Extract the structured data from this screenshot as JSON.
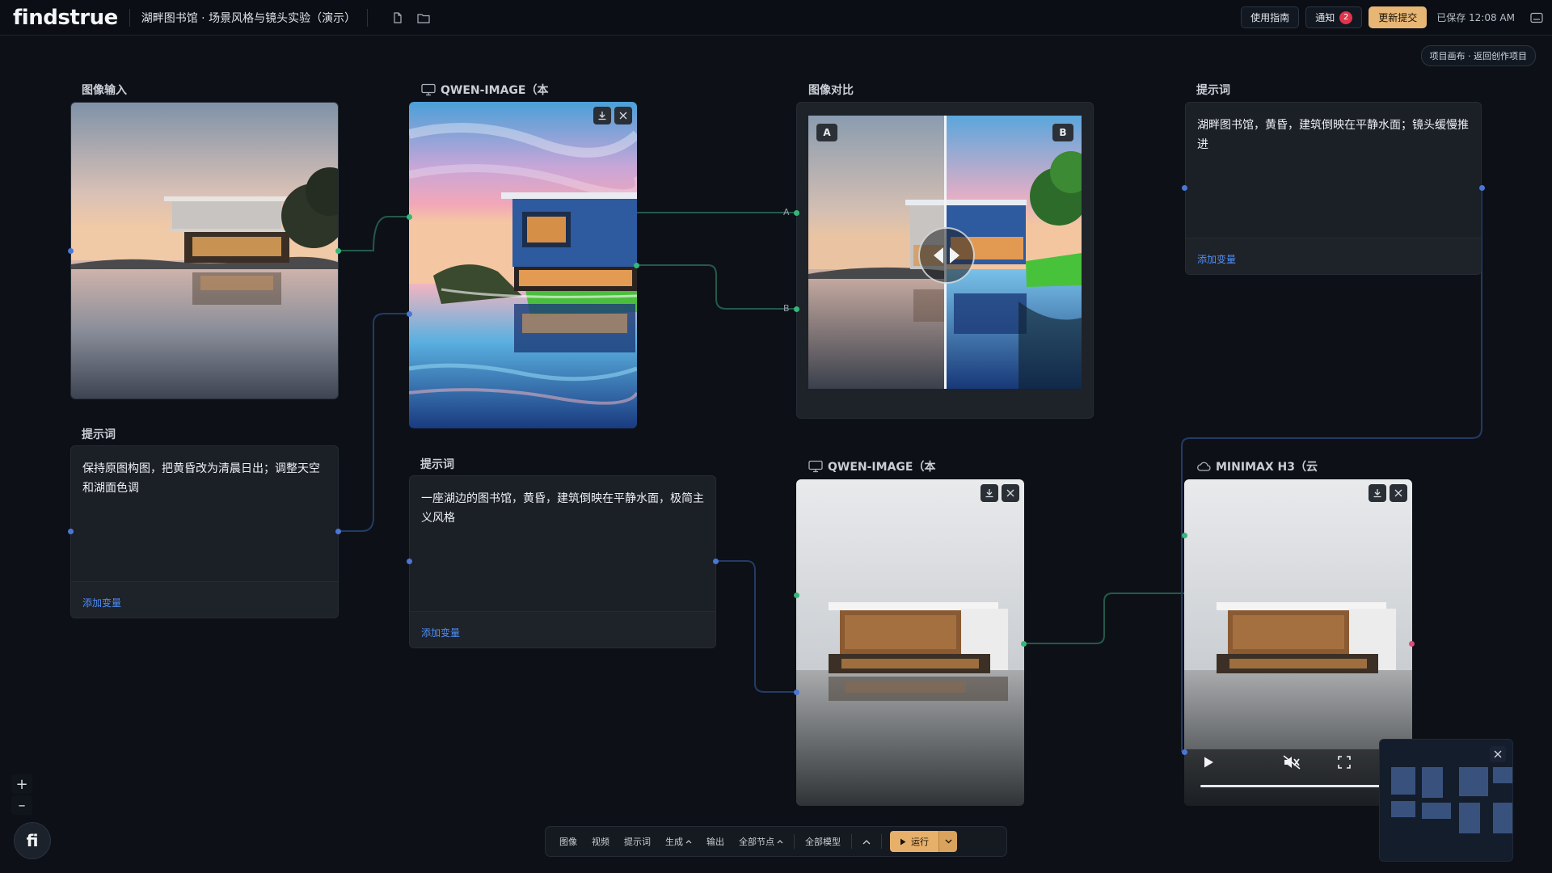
{
  "app": {
    "logo": "findstrue",
    "project_title": "湖畔图书馆 · 场景风格与镜头实验（演示）"
  },
  "topbar": {
    "guide": "使用指南",
    "notify": "通知",
    "notify_count": "2",
    "submit": "更新提交",
    "saved": "已保存 12:08 AM",
    "canvas_button": "项目画布 · 返回创作项目"
  },
  "nodes": {
    "image_input": {
      "title": "图像输入"
    },
    "qwen1": {
      "title": "QWEN-IMAGE（本"
    },
    "compare": {
      "title": "图像对比",
      "label_a": "A",
      "label_b": "B",
      "port_a": "A",
      "port_b": "B"
    },
    "prompt_right": {
      "title": "提示词",
      "text": "湖畔图书馆，黄昏，建筑倒映在平静水面；镜头缓慢推进",
      "add_var": "添加变量"
    },
    "prompt_left": {
      "title": "提示词",
      "text": "保持原图构图，把黄昏改为清晨日出；调整天空和湖面色调",
      "add_var": "添加变量"
    },
    "prompt_mid": {
      "title": "提示词",
      "text": "一座湖边的图书馆，黄昏，建筑倒映在平静水面，极简主义风格",
      "add_var": "添加变量"
    },
    "qwen2": {
      "title": "QWEN-IMAGE（本"
    },
    "minimax": {
      "title": "MINIMAX H3（云"
    }
  },
  "bottombar": {
    "items": [
      "图像",
      "视频",
      "提示词",
      "生成",
      "输出",
      "全部节点",
      "全部模型"
    ],
    "run": "运行"
  },
  "zoom": {
    "plus": "+",
    "minus": "–"
  },
  "fab": {
    "label": "fi"
  },
  "video": {
    "progress": 1.0
  }
}
